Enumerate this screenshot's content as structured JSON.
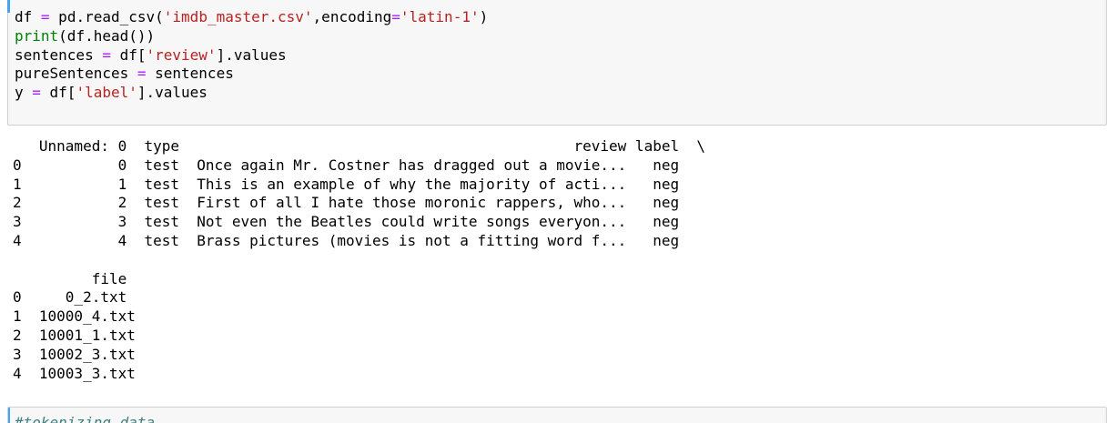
{
  "cell_1": {
    "code": {
      "l1_a": "df ",
      "l1_eq": "=",
      "l1_b": " pd.read_csv(",
      "l1_s1": "'imdb_master.csv'",
      "l1_c": ",encoding",
      "l1_eq2": "=",
      "l1_s2": "'latin-1'",
      "l1_d": ")",
      "l2_kw": "print",
      "l2_rest": "(df.head())",
      "l3_a": "sentences ",
      "l3_eq": "=",
      "l3_b": " df[",
      "l3_s": "'review'",
      "l3_c": "].values",
      "l4_a": "pureSentences ",
      "l4_eq": "=",
      "l4_b": " sentences",
      "l5_a": "y ",
      "l5_eq": "=",
      "l5_b": " df[",
      "l5_s": "'label'",
      "l5_c": "].values"
    }
  },
  "output": {
    "block1_header": "   Unnamed: 0  type                                             review label  \\",
    "block1_rows": [
      "0           0  test  Once again Mr. Costner has dragged out a movie...   neg",
      "1           1  test  This is an example of why the majority of acti...   neg",
      "2           2  test  First of all I hate those moronic rappers, who...   neg",
      "3           3  test  Not even the Beatles could write songs everyon...   neg",
      "4           4  test  Brass pictures (movies is not a fitting word f...   neg"
    ],
    "block2_header": "         file",
    "block2_rows": [
      "0     0_2.txt",
      "1  10000_4.txt",
      "2  10001_1.txt",
      "3  10002_3.txt",
      "4  10003_3.txt"
    ]
  },
  "cell_2": {
    "comment": "#tokenizing data"
  }
}
